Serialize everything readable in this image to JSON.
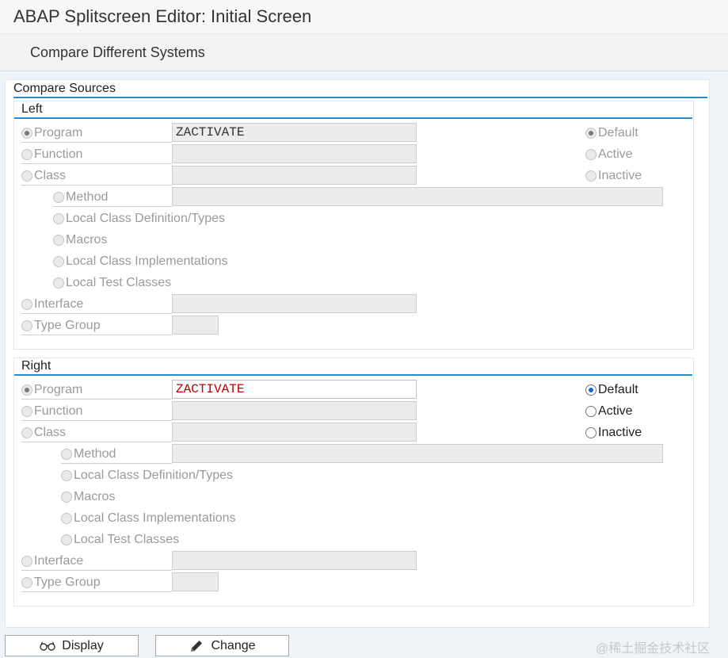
{
  "window": {
    "title": "ABAP Splitscreen Editor: Initial Screen"
  },
  "toolbar": {
    "compare_label": "Compare Different Systems"
  },
  "compare_sources": {
    "title": "Compare Sources",
    "left": {
      "title": "Left",
      "program_label": "Program",
      "program_value": "ZACTIVATE",
      "function_label": "Function",
      "class_label": "Class",
      "method_label": "Method",
      "local_class_def_label": "Local Class Definition/Types",
      "macros_label": "Macros",
      "local_class_impl_label": "Local Class Implementations",
      "local_test_label": "Local Test Classes",
      "interface_label": "Interface",
      "type_group_label": "Type Group",
      "default_label": "Default",
      "active_label": "Active",
      "inactive_label": "Inactive"
    },
    "right": {
      "title": "Right",
      "program_label": "Program",
      "program_value": "ZACTIVATE",
      "function_label": "Function",
      "class_label": "Class",
      "method_label": "Method",
      "local_class_def_label": "Local Class Definition/Types",
      "macros_label": "Macros",
      "local_class_impl_label": "Local Class Implementations",
      "local_test_label": "Local Test Classes",
      "interface_label": "Interface",
      "type_group_label": "Type Group",
      "default_label": "Default",
      "active_label": "Active",
      "inactive_label": "Inactive"
    }
  },
  "buttons": {
    "display_label": "Display",
    "change_label": "Change"
  },
  "watermark": "@稀土掘金技术社区",
  "colors": {
    "accent": "#2a8cc4",
    "selected_dot": "#0a6ed1",
    "value_red": "#c00000"
  },
  "icons": {
    "display": "glasses-icon",
    "change": "pencil-icon"
  }
}
